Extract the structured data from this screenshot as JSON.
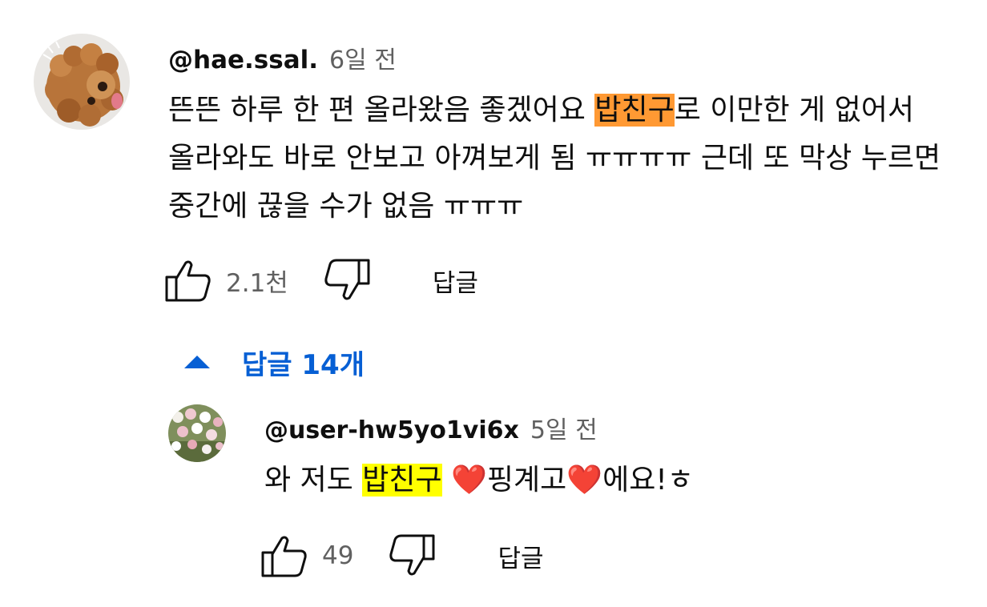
{
  "comment": {
    "author": "@hae.ssal.",
    "time": "6일 전",
    "text_before": "뜬뜬 하루 한 편 올라왔음 좋겠어요 ",
    "highlight": "밥친구",
    "text_after": "로 이만한 게 없어서 올라와도 바로 안보고 아껴보게 됨 ㅠㅠㅠㅠ 근데 또 막상 누르면 중간에 끊을 수가 없음 ㅠㅠㅠ",
    "like_count": "2.1천",
    "reply_label": "답글",
    "highlight_color": "#ff9933"
  },
  "replies_toggle": {
    "label": "답글 14개",
    "icon": "chevron-up-icon",
    "color": "#065fd4"
  },
  "reply": {
    "author": "@user-hw5yo1vi6x",
    "time": "5일 전",
    "text_part1": "와 저도 ",
    "highlight": "밥친구",
    "heart1": "❤️",
    "text_part2": "핑계고",
    "heart2": "❤️",
    "text_part3": "에요!ㅎ",
    "like_count": "49",
    "reply_label": "답글",
    "highlight_color": "#ffff00"
  },
  "icons": [
    "avatar-dog-icon",
    "avatar-tulips-icon",
    "thumbs-up-icon",
    "thumbs-down-icon",
    "chevron-up-icon"
  ]
}
